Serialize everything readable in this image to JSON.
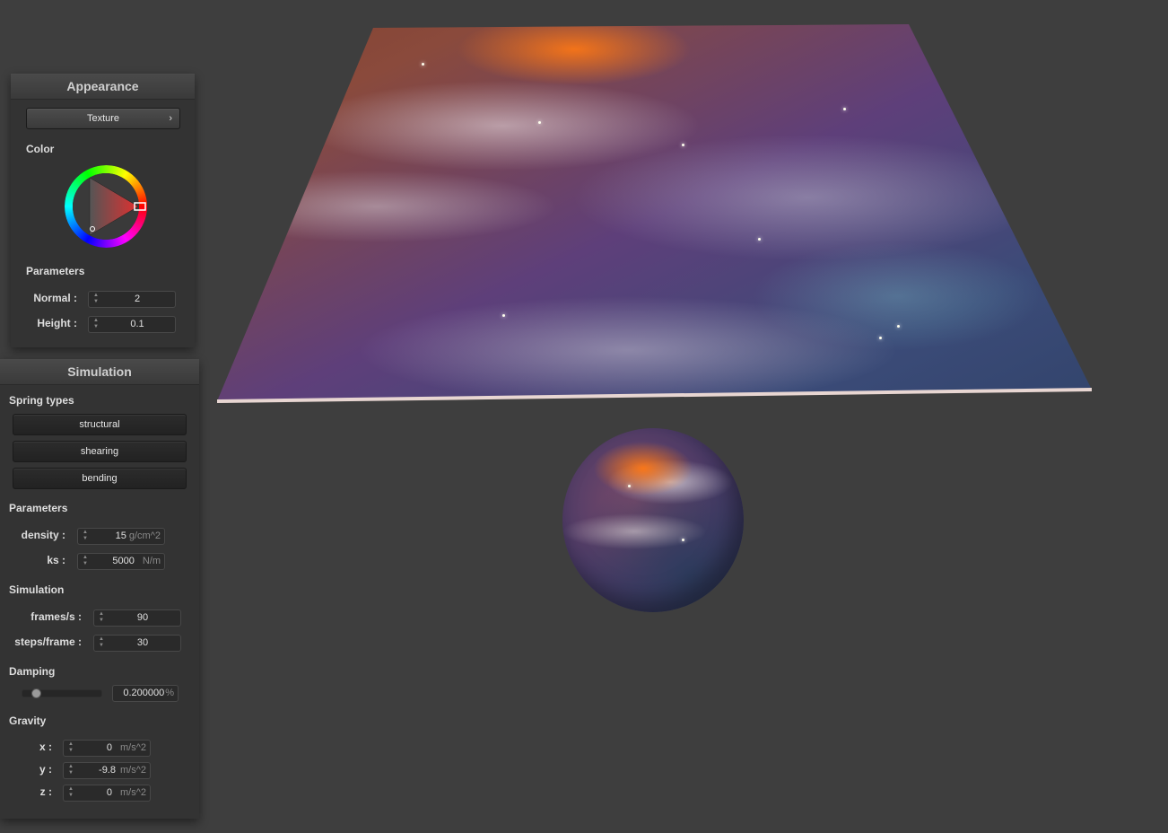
{
  "appearance": {
    "title": "Appearance",
    "shader_button": "Texture",
    "color_label": "Color",
    "parameters_label": "Parameters",
    "normal_label": "Normal :",
    "normal_value": "2",
    "height_label": "Height :",
    "height_value": "0.1"
  },
  "simulation": {
    "title": "Simulation",
    "spring_types_label": "Spring types",
    "spring_types": [
      "structural",
      "shearing",
      "bending"
    ],
    "parameters_label": "Parameters",
    "density_label": "density :",
    "density_value": "15",
    "density_unit": "g/cm^2",
    "ks_label": "ks :",
    "ks_value": "5000",
    "ks_unit": "N/m",
    "sim_label": "Simulation",
    "fps_label": "frames/s :",
    "fps_value": "90",
    "steps_label": "steps/frame :",
    "steps_value": "30",
    "damping_label": "Damping",
    "damping_value": "0.200000",
    "damping_unit": "%",
    "damping_slider_fraction": 0.2,
    "gravity_label": "Gravity",
    "gx_label": "x :",
    "gx_value": "0",
    "gy_label": "y :",
    "gy_value": "-9.8",
    "gz_label": "z :",
    "gz_value": "0",
    "gravity_unit": "m/s^2"
  },
  "colors": {
    "background": "#3e3e3e",
    "panel": "#333333",
    "color_wheel_selected": "#e04040"
  }
}
